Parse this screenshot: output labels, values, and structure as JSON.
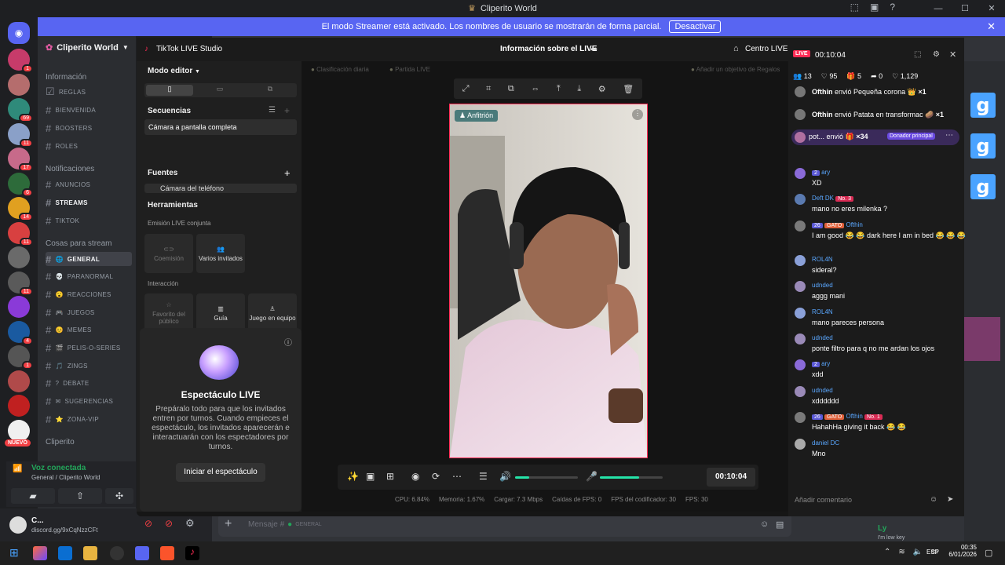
{
  "window": {
    "title": "Cliperito World"
  },
  "banner": {
    "text": "El modo Streamer está activado. Los nombres de usuario se mostrarán de forma parcial.",
    "button": "Desactivar"
  },
  "server": {
    "name": "Cliperito World",
    "servers": [
      {
        "badge": "1",
        "color": "#c73b6a"
      },
      {
        "badge": "",
        "color": "#b56d6d"
      },
      {
        "badge": "69",
        "color": "#2f8a7a"
      },
      {
        "badge": "11",
        "color": "#8aa0c8"
      },
      {
        "badge": "17",
        "color": "#c76a8a"
      },
      {
        "badge": "6",
        "color": "#2d6b3a"
      },
      {
        "badge": "14",
        "color": "#e0a020"
      },
      {
        "badge": "11",
        "color": "#d84040"
      },
      {
        "badge": "",
        "color": "#6a6a6a"
      },
      {
        "badge": "11",
        "color": "#5a5a5a"
      },
      {
        "badge": "",
        "color": "#8a3ad8"
      },
      {
        "badge": "4",
        "color": "#1a5aa0"
      },
      {
        "badge": "1",
        "color": "#555555"
      },
      {
        "badge": "",
        "color": "#b04a4a"
      },
      {
        "badge": "",
        "color": "#c02020"
      },
      {
        "badge": "",
        "color": "#f0f0f0"
      }
    ],
    "new_label": "NUEVO"
  },
  "sidebar": {
    "categories": [
      "Información",
      "Notificaciones",
      "Cosas para stream",
      "Cliperito"
    ],
    "info_channels": [
      "REGLAS",
      "BIENVENIDA",
      "BOOSTERS",
      "ROLES"
    ],
    "notif_channels": [
      "ANUNCIOS",
      "STREAMS",
      "TIKTOK"
    ],
    "stream_channels": [
      "GENERAL",
      "PARANORMAL",
      "REACCIONES",
      "JUEGOS",
      "MEMES",
      "PELIS-O-SERIES",
      "ZINGS",
      "DEBATE",
      "SUGERENCIAS",
      "ZONA-VIP"
    ]
  },
  "voice": {
    "status": "Voz conectada",
    "channel": "General / Cliperito World"
  },
  "user": {
    "name": "C...",
    "status": "discord.gg/9xCqNzzCFt"
  },
  "message_bar": {
    "placeholder": "Mensaje #",
    "channel": "GENERAL"
  },
  "tiktok": {
    "app_title": "TikTok LIVE Studio",
    "center_title": "Información sobre el LIVE",
    "live_center": "Centro LIVE",
    "mode": "Modo editor",
    "sequences_label": "Secuencias",
    "sequence_item": "Cámara a pantalla completa",
    "sources_label": "Fuentes",
    "source_item": "Cámara del teléfono",
    "tools_label": "Herramientas",
    "joint_label": "Emisión LIVE conjunta",
    "cohost": "Coemisión",
    "multi_guest": "Varios invitados",
    "interaction_label": "Interacción",
    "fav": "Favorito del público",
    "guide": "Guía",
    "game": "Juego en equipo",
    "show_title": "Espectáculo LIVE",
    "show_desc": "Prepáralo todo para que los invitados entren por turnos. Cuando empieces el espectáculo, los invitados aparecerán e interactuarán con los espectadores por turnos.",
    "show_button": "Iniciar el espectáculo",
    "daily_rank": "Clasificación diaria",
    "match": "Partida LIVE",
    "goal": "Añadir un objetivo de Regalos",
    "host_label": "Anfitrión",
    "timer": "00:10:04",
    "stats": {
      "cpu": "CPU: 6.84%",
      "memory": "Memoria: 1.67%",
      "upload": "Cargar: 7.3 Mbps",
      "fps_drop": "Caídas de FPS: 0",
      "encoder_fps": "FPS del codificador: 30",
      "fps": "FPS: 30"
    }
  },
  "live_chat": {
    "live_badge": "LIVE",
    "timer": "00:10:04",
    "counts": {
      "viewers": "13",
      "likes": "95",
      "gifts": "5",
      "shares": "0",
      "hearts": "1,129"
    },
    "gifts": [
      {
        "user": "Ofthin",
        "text": "envió Pequeña corona",
        "count": "×1"
      },
      {
        "user": "Ofthin",
        "text": "envió Patata en transformac",
        "count": "×1"
      }
    ],
    "top_gift": {
      "user": "pot...",
      "text": "envió",
      "count": "×34",
      "badge": "Donador principal"
    },
    "messages": [
      {
        "user": "ary",
        "level": "2",
        "text": "XD"
      },
      {
        "user": "Deft DK",
        "rank": "No. 3",
        "text": "mano no eres milenka ?"
      },
      {
        "user": "Ofthin",
        "level": "26",
        "gato": "GATO",
        "text": "I am good 😂 😂 dark here I am in bed 😂 😂 😂"
      },
      {
        "user": "ROL4N",
        "text": "sideral?"
      },
      {
        "user": "udnded",
        "text": "aggg mani"
      },
      {
        "user": "ROL4N",
        "text": "mano pareces persona"
      },
      {
        "user": "udnded",
        "text": "ponte filtro para q no me ardan los ojos"
      },
      {
        "user": "ary",
        "level": "2",
        "text": "xdd"
      },
      {
        "user": "udnded",
        "text": "xdddddd"
      },
      {
        "user": "Ofthin",
        "level": "26",
        "gato": "GATO",
        "rank": "No. 1",
        "text": "HahahHa giving it back 😂 😂"
      },
      {
        "user": "daniel DC",
        "text": "Mno"
      }
    ],
    "input_placeholder": "Añadir comentario"
  },
  "taskbar": {
    "lang": "ESP",
    "time": "00:35",
    "date": "6/01/2026"
  },
  "right_panel": {
    "user": "Ly",
    "status": "I'm low key"
  }
}
